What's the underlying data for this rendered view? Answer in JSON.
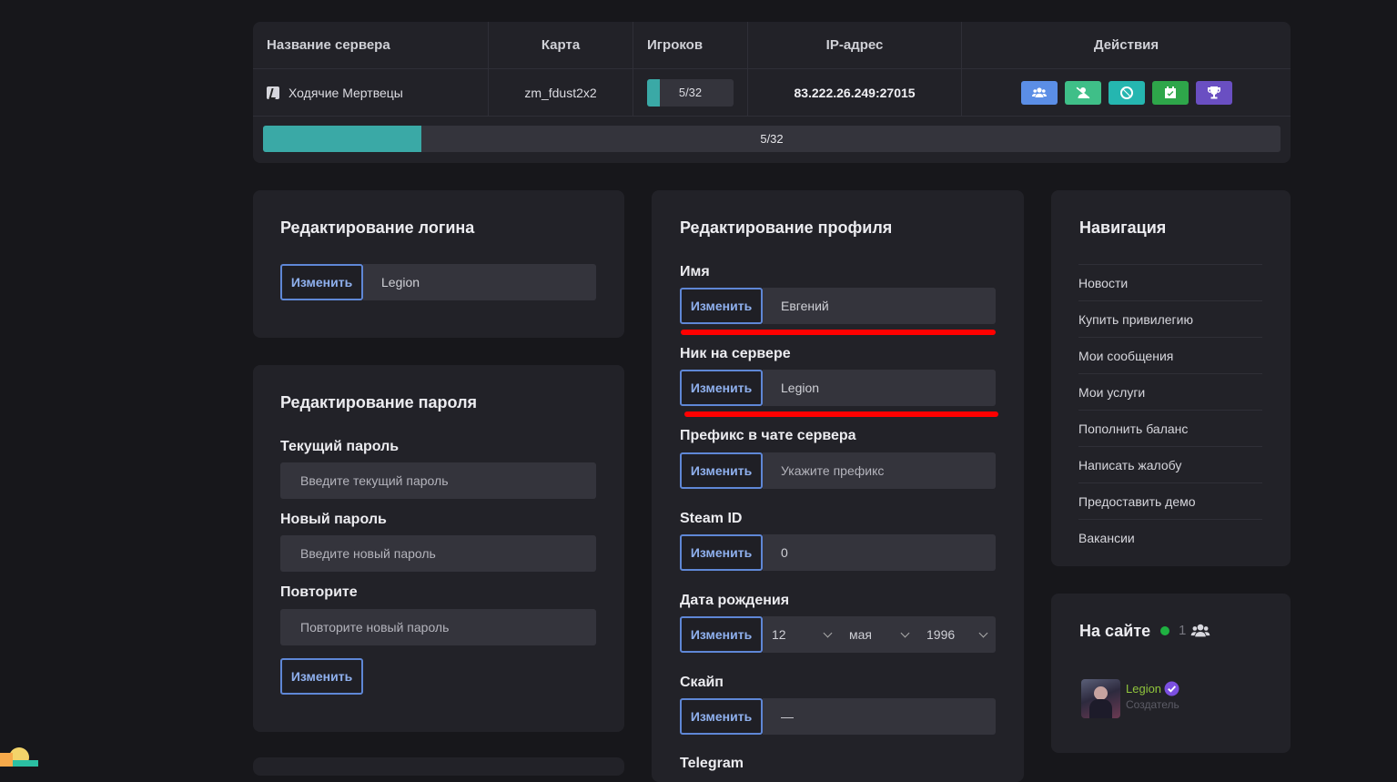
{
  "server_table": {
    "headers": {
      "name": "Название сервера",
      "map": "Карта",
      "players": "Игроков",
      "ip": "IP-адрес",
      "actions": "Действия"
    },
    "row": {
      "name": "Ходячие Мертвецы",
      "map": "zm_fdust2x2",
      "players": "5/32",
      "players_fraction": 0.156,
      "ip": "83.222.26.249:27015"
    },
    "actions": [
      {
        "icon": "users-icon",
        "color": "#5b8ee6"
      },
      {
        "icon": "user-slash-icon",
        "color": "#3fbf88"
      },
      {
        "icon": "ban-icon",
        "color": "#25b6b0"
      },
      {
        "icon": "calendar-icon",
        "color": "#2ea64a"
      },
      {
        "icon": "trophy-icon",
        "color": "#6a4fc2"
      }
    ],
    "progress_label": "5/32"
  },
  "login_card": {
    "title": "Редактирование логина",
    "button": "Изменить",
    "value": "Legion"
  },
  "password_card": {
    "title": "Редактирование пароля",
    "current_label": "Текущий пароль",
    "current_placeholder": "Введите текущий пароль",
    "new_label": "Новый пароль",
    "new_placeholder": "Введите новый пароль",
    "repeat_label": "Повторите",
    "repeat_placeholder": "Повторите новый пароль",
    "button": "Изменить"
  },
  "profile_card": {
    "title": "Редактирование профиля",
    "button": "Изменить",
    "name_label": "Имя",
    "name_value": "Евгений",
    "nick_label": "Ник на сервере",
    "nick_value": "Legion",
    "prefix_label": "Префикс в чате сервера",
    "prefix_placeholder": "Укажите префикс",
    "steam_label": "Steam ID",
    "steam_value": "0",
    "birth_label": "Дата рождения",
    "birth_day": "12",
    "birth_month": "мая",
    "birth_year": "1996",
    "skype_label": "Скайп",
    "skype_value": "—",
    "telegram_label": "Telegram"
  },
  "nav_card": {
    "title": "Навигация",
    "items": [
      "Новости",
      "Купить привилегию",
      "Мои сообщения",
      "Мои услуги",
      "Пополнить баланс",
      "Написать жалобу",
      "Предоставить демо",
      "Вакансии"
    ]
  },
  "online_card": {
    "title": "На сайте",
    "count": "1",
    "user": {
      "name": "Legion",
      "role": "Создатель",
      "name_color": "#8fc43c"
    }
  }
}
